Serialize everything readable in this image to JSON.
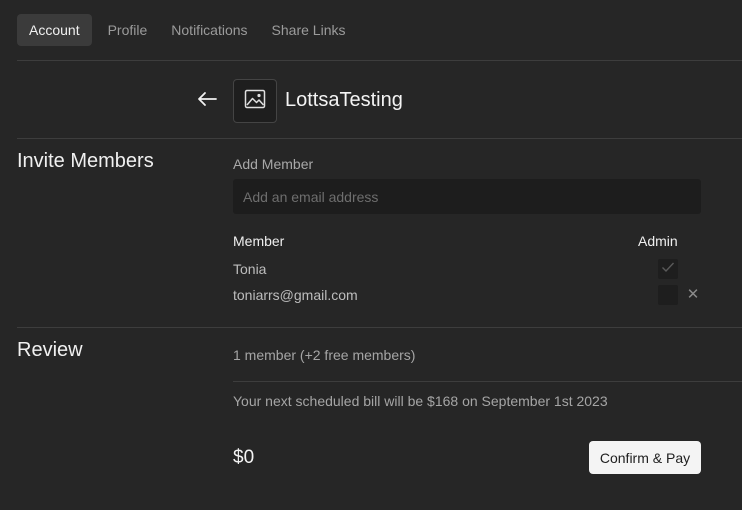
{
  "tabs": [
    {
      "label": "Account",
      "active": true
    },
    {
      "label": "Profile",
      "active": false
    },
    {
      "label": "Notifications",
      "active": false
    },
    {
      "label": "Share Links",
      "active": false
    }
  ],
  "header": {
    "back_icon": "arrow-left-icon",
    "workspace_icon": "image-icon",
    "workspace_name": "LottsaTesting"
  },
  "invite": {
    "title": "Invite Members",
    "add_label": "Add Member",
    "email_placeholder": "Add an email address",
    "email_value": "",
    "columns": {
      "member": "Member",
      "admin": "Admin"
    },
    "members": [
      {
        "name": "Tonia",
        "admin": true,
        "removable": false
      },
      {
        "name": "toniarrs@gmail.com",
        "admin": false,
        "removable": true
      }
    ]
  },
  "review": {
    "title": "Review",
    "member_summary": "1 member (+2 free members)",
    "next_bill": "Your next scheduled bill will be $168 on September 1st 2023",
    "total": "$0",
    "confirm_label": "Confirm & Pay"
  },
  "colors": {
    "background": "#262626",
    "divider": "#3d3d3d",
    "button_bg": "#f4f4f4"
  }
}
